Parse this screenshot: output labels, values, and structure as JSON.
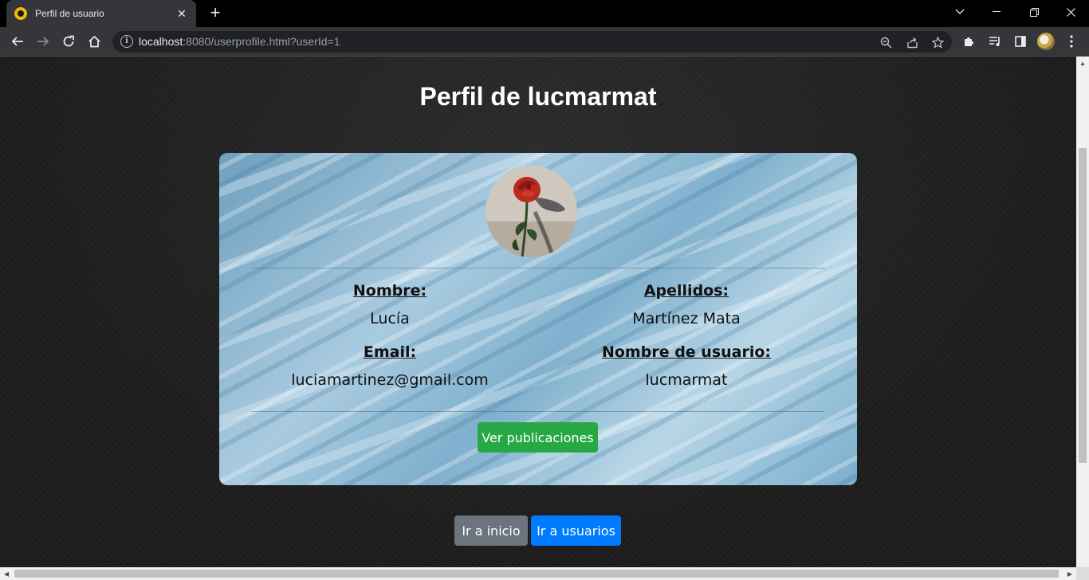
{
  "browser": {
    "tab": {
      "title": "Perfil de usuario",
      "close_glyph": "✕",
      "favicon": "ubuntu-style-favicon-icon"
    },
    "new_tab_glyph": "+",
    "window_controls": {
      "dropdown": "⌄",
      "minimize": "—",
      "restore": "❐",
      "close": "✕"
    },
    "address": {
      "host": "localhost",
      "rest": ":8080/userprofile.html?userId=1"
    },
    "toolbar_icons": [
      "back-icon",
      "forward-icon",
      "reload-icon",
      "home-icon",
      "zoom-icon",
      "share-icon",
      "star-icon",
      "extensions-icon",
      "media-icon",
      "sidepanel-icon",
      "avatar",
      "menu-icon"
    ]
  },
  "page": {
    "title": "Perfil de lucmarmat",
    "profile": {
      "name_label": "Nombre:",
      "name_value": "Lucía",
      "surname_label": "Apellidos:",
      "surname_value": "Martínez Mata",
      "email_label": "Email:",
      "email_value": "luciamartinez@gmail.com",
      "username_label": "Nombre de usuario:",
      "username_value": "lucmarmat"
    },
    "buttons": {
      "posts": "Ver publicaciones",
      "home": "Ir a inicio",
      "users": "Ir a usuarios"
    }
  },
  "colors": {
    "green": "#28a745",
    "grey": "#6c757d",
    "blue": "#007bff"
  }
}
